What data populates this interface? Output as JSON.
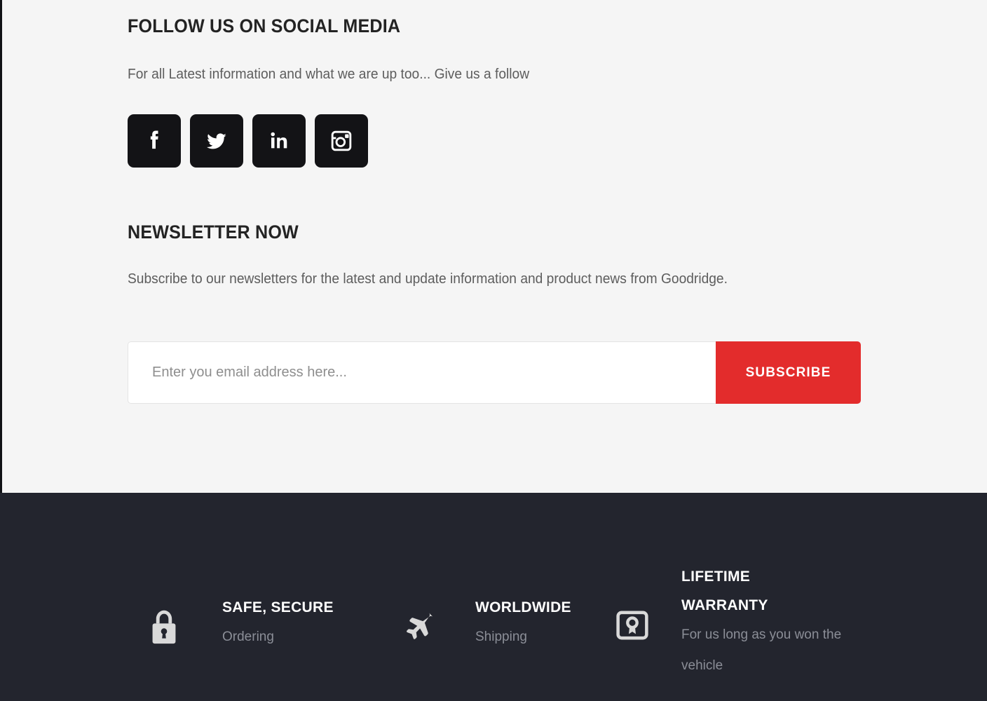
{
  "follow": {
    "title": "FOLLOW US ON SOCIAL MEDIA",
    "subtitle": "For all Latest information and what we are up too... Give us a follow",
    "socials": [
      {
        "name": "facebook",
        "label": "Facebook"
      },
      {
        "name": "twitter",
        "label": "Twitter"
      },
      {
        "name": "linkedin",
        "label": "LinkedIn"
      },
      {
        "name": "instagram",
        "label": "Instagram"
      }
    ]
  },
  "newsletter": {
    "title": "NEWSLETTER NOW",
    "subtitle": "Subscribe to our newsletters for the latest and update information and product news from Goodridge.",
    "email_placeholder": "Enter you email address here...",
    "email_value": "",
    "subscribe_label": "SUBSCRIBE"
  },
  "footer": {
    "badges": [
      {
        "icon": "lock-icon",
        "title": "SAFE, SECURE",
        "subtitle": "Ordering"
      },
      {
        "icon": "airplane-icon",
        "title": "WORLDWIDE",
        "subtitle": "Shipping"
      },
      {
        "icon": "warranty-certificate-icon",
        "title": "LIFETIME WARRANTY",
        "subtitle": "For us long as you won the vehicle"
      }
    ]
  },
  "colors": {
    "accent_red": "#e32c2c",
    "light_bg": "#f5f5f5",
    "dark_bg": "#23252e",
    "social_tile": "#131316",
    "muted_text": "#8b8e97"
  }
}
